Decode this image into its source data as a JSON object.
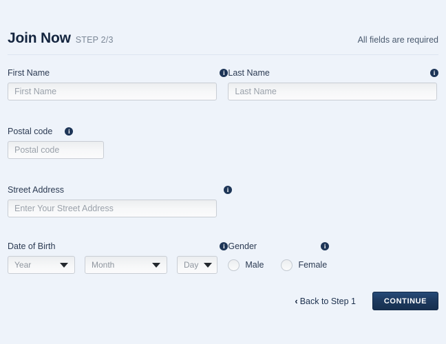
{
  "header": {
    "title": "Join Now",
    "step": "STEP 2/3",
    "required_note": "All fields are required",
    "info_icon_glyph": "i"
  },
  "fields": {
    "first_name": {
      "label": "First Name",
      "placeholder": "First Name",
      "value": ""
    },
    "last_name": {
      "label": "Last Name",
      "placeholder": "Last Name",
      "value": ""
    },
    "postal_code": {
      "label": "Postal code",
      "placeholder": "Postal code",
      "value": ""
    },
    "street_address": {
      "label": "Street Address",
      "placeholder": "Enter Your Street Address",
      "value": ""
    },
    "date_of_birth": {
      "label": "Date of Birth",
      "year": "Year",
      "month": "Month",
      "day": "Day"
    },
    "gender": {
      "label": "Gender",
      "options": [
        {
          "label": "Male",
          "selected": false
        },
        {
          "label": "Female",
          "selected": false
        }
      ]
    }
  },
  "footer": {
    "back_chevron": "‹",
    "back_label": "Back to Step 1",
    "continue_label": "CONTINUE"
  },
  "colors": {
    "page_background": "#eef3fa",
    "accent_navy": "#1d3557",
    "button_navy": "#1d3a5f",
    "text_primary": "#1b2a45",
    "text_muted": "#7b8796",
    "input_border": "#c8cdd4"
  }
}
